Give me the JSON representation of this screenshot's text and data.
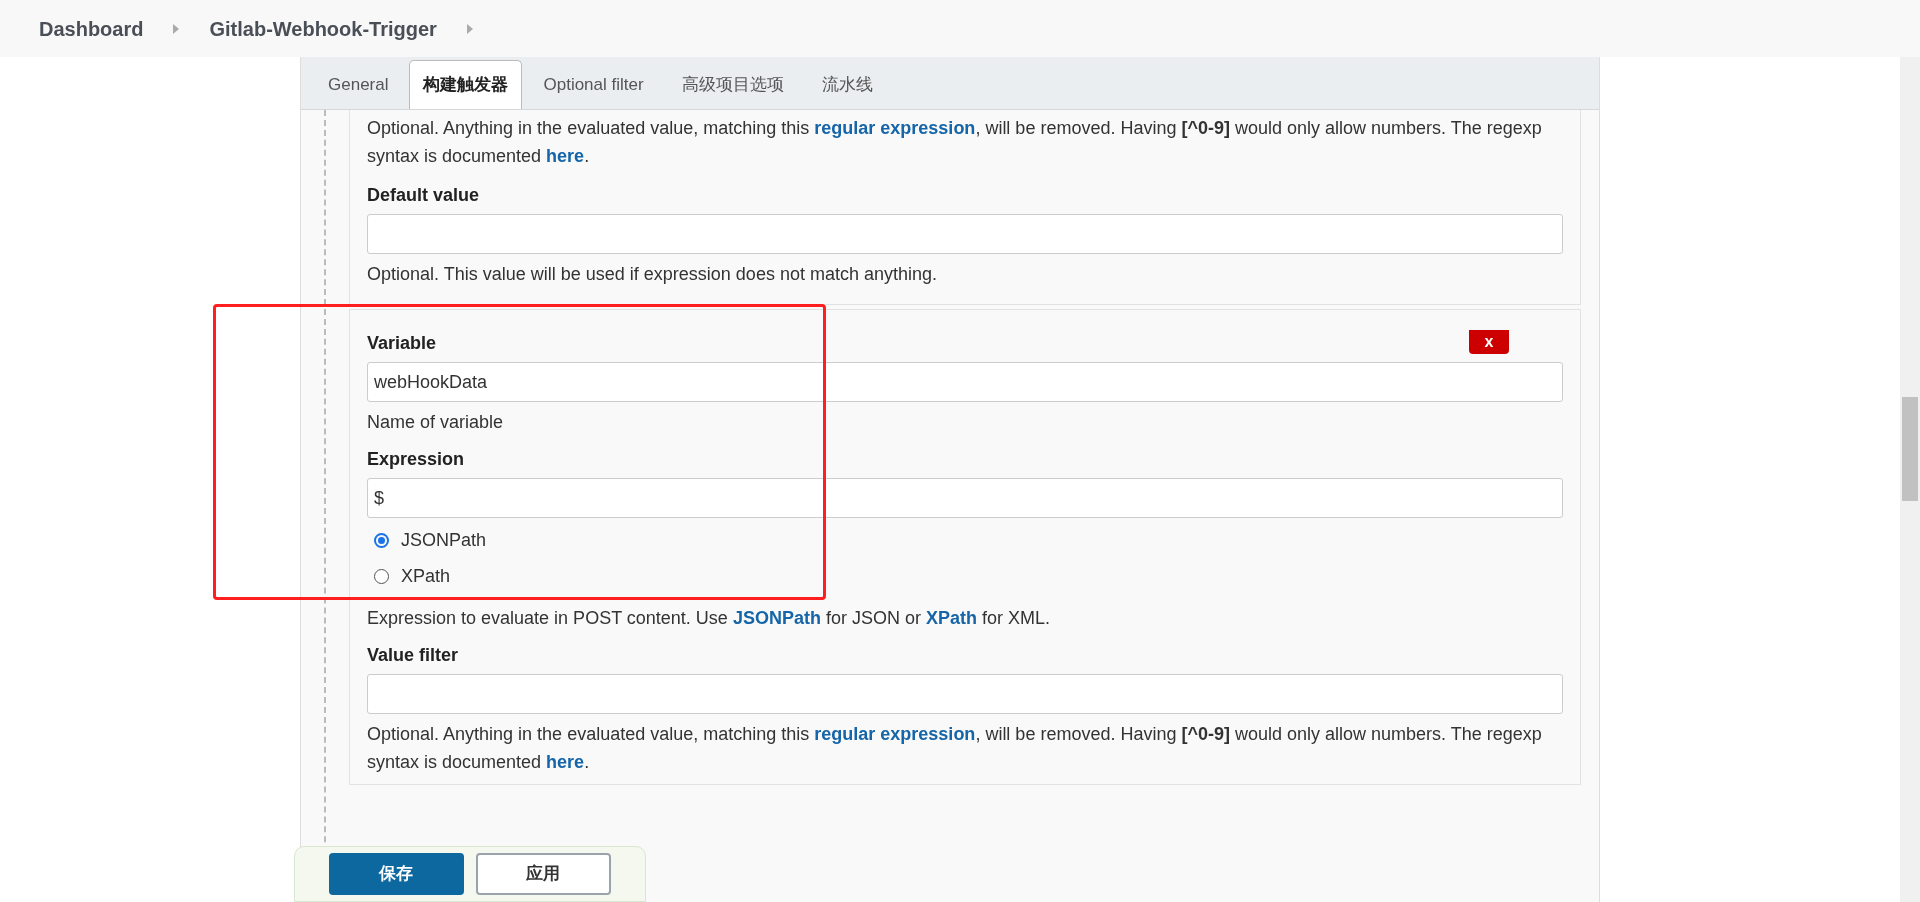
{
  "breadcrumb": [
    {
      "label": "Dashboard"
    },
    {
      "label": "Gitlab-Webhook-Trigger"
    }
  ],
  "tabs": [
    {
      "label": "General",
      "selected": false
    },
    {
      "label": "构建触发器",
      "selected": true
    },
    {
      "label": "Optional filter",
      "selected": false
    },
    {
      "label": "高级项目选项",
      "selected": false
    },
    {
      "label": "流水线",
      "selected": false
    }
  ],
  "previous_parameter": {
    "help": [
      {
        "kind": "text",
        "text": "Optional. Anything in the evaluated value, matching this "
      },
      {
        "kind": "link",
        "text": "regular expression"
      },
      {
        "kind": "text",
        "text": ", will be removed. Having "
      },
      {
        "kind": "code",
        "text": "[^0-9]"
      },
      {
        "kind": "text",
        "text": " would only allow numbers. The regexp syntax is documented "
      },
      {
        "kind": "link",
        "text": "here"
      },
      {
        "kind": "text",
        "text": "."
      }
    ],
    "default_value": {
      "label": "Default value",
      "help": "Optional. This value will be used if expression does not match anything."
    }
  },
  "parameter": {
    "delete_button": "x",
    "variable": {
      "label": "Variable",
      "value": "webHookData",
      "help": "Name of variable"
    },
    "expression": {
      "label": "Expression",
      "value": "$",
      "options": [
        {
          "label": "JSONPath",
          "selected": true
        },
        {
          "label": "XPath",
          "selected": false
        }
      ],
      "help": [
        {
          "kind": "text",
          "text": "Expression to evaluate in POST content. Use "
        },
        {
          "kind": "link",
          "text": "JSONPath"
        },
        {
          "kind": "text",
          "text": " for JSON or "
        },
        {
          "kind": "link",
          "text": "XPath"
        },
        {
          "kind": "text",
          "text": " for XML."
        }
      ]
    },
    "value_filter": {
      "label": "Value filter",
      "help": [
        {
          "kind": "text",
          "text": "Optional. Anything in the evaluated value, matching this "
        },
        {
          "kind": "link",
          "text": "regular expression"
        },
        {
          "kind": "text",
          "text": ", will be removed. Having "
        },
        {
          "kind": "code",
          "text": "[^0-9]"
        },
        {
          "kind": "text",
          "text": " would only allow numbers. The regexp syntax is documented "
        },
        {
          "kind": "link",
          "text": "here"
        },
        {
          "kind": "text",
          "text": "."
        }
      ]
    }
  },
  "actions": [
    {
      "label": "保存",
      "kind": "primary"
    },
    {
      "label": "应用",
      "kind": "secondary"
    }
  ]
}
